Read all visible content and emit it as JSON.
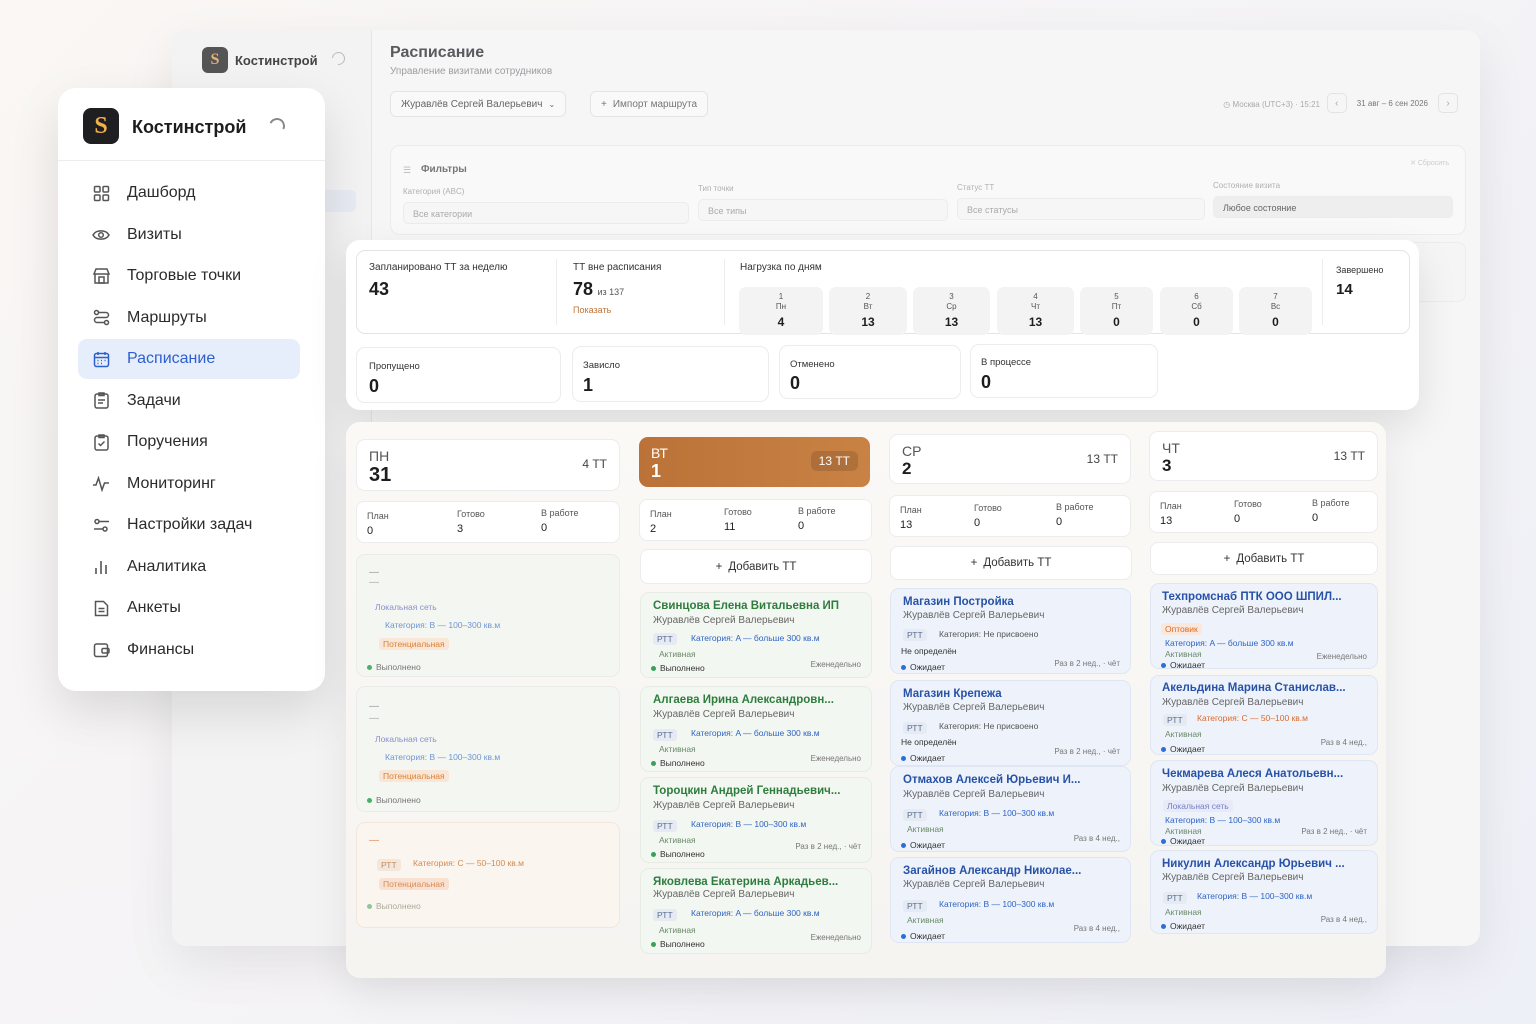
{
  "bg": {
    "brand": "Костинстрой",
    "title": "Расписание",
    "subtitle": "Управление визитами сотрудников",
    "employee": "Журавлёв Сергей Валерьевич",
    "import": "Импорт маршрута",
    "time": "Москва (UTC+3) · 15:21",
    "range": "31 авг – 6 сен 2026",
    "filters_title": "Фильтры",
    "reset": "✕ Сбросить",
    "filters": [
      {
        "label": "Категория (ABC)",
        "value": "Все категории"
      },
      {
        "label": "Тип точки",
        "value": "Все типы"
      },
      {
        "label": "Статус ТТ",
        "value": "Все статусы"
      },
      {
        "label": "Состояние визита",
        "value": "Любое состояние"
      }
    ]
  },
  "sidebar": {
    "brand": "Костинстрой",
    "items": [
      {
        "label": "Дашборд",
        "icon": "grid-icon"
      },
      {
        "label": "Визиты",
        "icon": "eye-icon"
      },
      {
        "label": "Торговые точки",
        "icon": "store-icon"
      },
      {
        "label": "Маршруты",
        "icon": "route-icon"
      },
      {
        "label": "Расписание",
        "icon": "calendar-icon",
        "active": true
      },
      {
        "label": "Задачи",
        "icon": "clipboard-icon"
      },
      {
        "label": "Поручения",
        "icon": "clipboard-check-icon"
      },
      {
        "label": "Мониторинг",
        "icon": "pulse-icon"
      },
      {
        "label": "Настройки задач",
        "icon": "sliders-icon"
      },
      {
        "label": "Аналитика",
        "icon": "bar-chart-icon"
      },
      {
        "label": "Анкеты",
        "icon": "document-icon"
      },
      {
        "label": "Финансы",
        "icon": "wallet-icon"
      }
    ]
  },
  "stats": {
    "planned_label": "Запланировано ТТ за неделю",
    "planned_value": "43",
    "outside_label": "ТТ вне расписания",
    "outside_value": "78",
    "outside_of": "из 137",
    "show": "Показать",
    "load_label": "Нагрузка по дням",
    "days": [
      {
        "n": "1",
        "d": "Пн",
        "v": "4"
      },
      {
        "n": "2",
        "d": "Вт",
        "v": "13"
      },
      {
        "n": "3",
        "d": "Ср",
        "v": "13"
      },
      {
        "n": "4",
        "d": "Чт",
        "v": "13"
      },
      {
        "n": "5",
        "d": "Пт",
        "v": "0"
      },
      {
        "n": "6",
        "d": "Сб",
        "v": "0"
      },
      {
        "n": "7",
        "d": "Вс",
        "v": "0"
      }
    ],
    "done_label": "Завершено",
    "done_value": "14",
    "small": [
      {
        "label": "Пропущено",
        "value": "0"
      },
      {
        "label": "Зависло",
        "value": "1"
      },
      {
        "label": "Отменено",
        "value": "0"
      },
      {
        "label": "В процессе",
        "value": "0"
      }
    ]
  },
  "board": {
    "plan_label": "План",
    "ready_label": "Готово",
    "work_label": "В работе",
    "add_label": "Добавить ТТ",
    "columns": [
      {
        "dn": "ПН",
        "dd": "31",
        "cnt": "4 ТТ",
        "plan": "0",
        "ready": "3",
        "work": "0",
        "cards": [
          {
            "dash": "—",
            "net": "Локальная сеть",
            "cat": "Категория: B — 100–300 кв.м",
            "pot": "Потенциальная",
            "status": "Выполнено"
          },
          {
            "dash": "—",
            "net": "Локальная сеть",
            "cat": "Категория: B — 100–300 кв.м",
            "pot": "Потенциальная",
            "status": "Выполнено"
          },
          {
            "dash": "—",
            "rtt": "РТТ",
            "cat": "Категория: C — 50–100 кв.м",
            "pot": "Потенциальная",
            "status": "Выполнено"
          }
        ]
      },
      {
        "dn": "ВТ",
        "dd": "1",
        "cnt": "13 ТТ",
        "plan": "2",
        "ready": "11",
        "work": "0",
        "cards": [
          {
            "title": "Свинцова Елена Витальевна ИП",
            "emp": "Журавлёв Сергей Валерьевич",
            "rtt": "РТТ",
            "cat": "Категория: A — больше 300 кв.м",
            "act": "Активная",
            "status": "Выполнено",
            "freq": "Еженедельно"
          },
          {
            "title": "Алгаева Ирина Александровн...",
            "emp": "Журавлёв Сергей Валерьевич",
            "rtt": "РТТ",
            "cat": "Категория: A — больше 300 кв.м",
            "act": "Активная",
            "status": "Выполнено",
            "freq": "Еженедельно"
          },
          {
            "title": "Тороцкин Андрей Геннадьевич...",
            "emp": "Журавлёв Сергей Валерьевич",
            "rtt": "РТТ",
            "cat": "Категория: B — 100–300 кв.м",
            "act": "Активная",
            "status": "Выполнено",
            "freq": "Раз в 2 нед., · чёт"
          },
          {
            "title": "Яковлева Екатерина Аркадьев...",
            "emp": "Журавлёв Сергей Валерьевич",
            "rtt": "РТТ",
            "cat": "Категория: A — больше 300 кв.м",
            "act": "Активная",
            "status": "Выполнено",
            "freq": "Еженедельно"
          }
        ]
      },
      {
        "dn": "СР",
        "dd": "2",
        "cnt": "13 ТТ",
        "plan": "13",
        "ready": "0",
        "work": "0",
        "cards": [
          {
            "title": "Магазин Постройка",
            "emp": "Журавлёв Сергей Валерьевич",
            "rtt": "РТТ",
            "cat": "Категория: Не присвоено",
            "undef": "Не определён",
            "status": "Ожидает",
            "freq": "Раз в 2 нед., · чёт"
          },
          {
            "title": "Магазин Крепежа",
            "emp": "Журавлёв Сергей Валерьевич",
            "rtt": "РТТ",
            "cat": "Категория: Не присвоено",
            "undef": "Не определён",
            "status": "Ожидает",
            "freq": "Раз в 2 нед., · чёт"
          },
          {
            "title": "Отмахов Алексей Юрьевич И...",
            "emp": "Журавлёв Сергей Валерьевич",
            "rtt": "РТТ",
            "cat": "Категория: B — 100–300 кв.м",
            "act": "Активная",
            "status": "Ожидает",
            "freq": "Раз в 4 нед.,"
          },
          {
            "title": "Загайнов Александр Николае...",
            "emp": "Журавлёв Сергей Валерьевич",
            "rtt": "РТТ",
            "cat": "Категория: B — 100–300 кв.м",
            "act": "Активная",
            "status": "Ожидает",
            "freq": "Раз в 4 нед.,"
          }
        ]
      },
      {
        "dn": "ЧТ",
        "dd": "3",
        "cnt": "13 ТТ",
        "plan": "13",
        "ready": "0",
        "work": "0",
        "cards": [
          {
            "title": "Техпромснаб ПТК ООО ШПИЛ...",
            "emp": "Журавлёв Сергей Валерьевич",
            "opt": "Оптовик",
            "cat": "Категория: A — больше 300 кв.м",
            "act": "Активная",
            "status": "Ожидает",
            "freq": "Еженедельно"
          },
          {
            "title": "Акельдина Марина Станислав...",
            "emp": "Журавлёв Сергей Валерьевич",
            "rtt": "РТТ",
            "cat": "Категория: C — 50–100 кв.м",
            "act": "Активная",
            "status": "Ожидает",
            "freq": "Раз в 4 нед.,"
          },
          {
            "title": "Чекмарева Алеся Анатольевн...",
            "emp": "Журавлёв Сергей Валерьевич",
            "net": "Локальная сеть",
            "cat": "Категория: B — 100–300 кв.м",
            "act": "Активная",
            "status": "Ожидает",
            "freq": "Раз в 2 нед., · чёт"
          },
          {
            "title": "Никулин Александр Юрьевич ...",
            "emp": "Журавлёв Сергей Валерьевич",
            "rtt": "РТТ",
            "cat": "Категория: B — 100–300 кв.м",
            "act": "Активная",
            "status": "Ожидает",
            "freq": "Раз в 4 нед.,"
          }
        ]
      }
    ]
  },
  "colors": {
    "accent": "#2c5fcf",
    "today": "#bb7238",
    "done": "#3aa05a",
    "wait": "#2c6fd6"
  }
}
